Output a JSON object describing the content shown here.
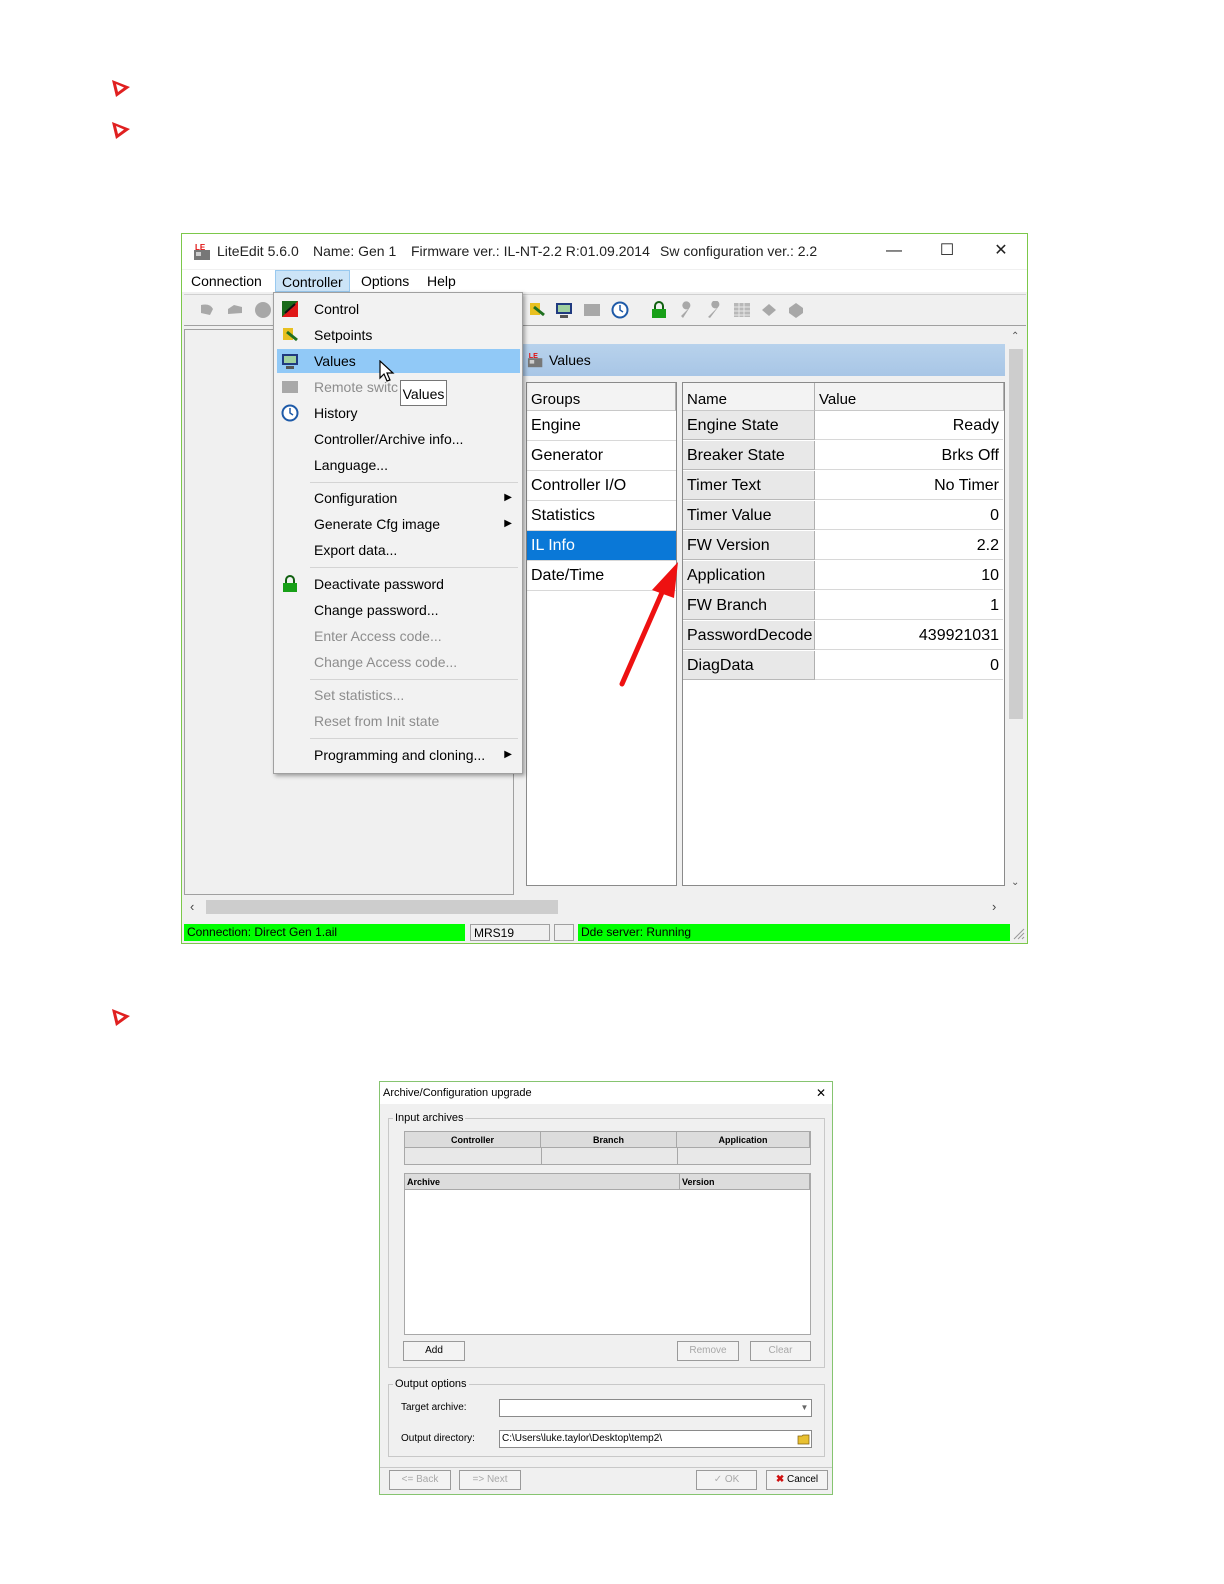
{
  "colors": {
    "accent": "#0a78d7",
    "status_green": "#00ff00",
    "window_border": "#7cc84a",
    "bullet_red": "#e02020",
    "arrow_red": "#ee1111"
  },
  "window1": {
    "title_app": "LiteEdit 5.6.0",
    "title_name": "Name: Gen 1",
    "title_firmware": "Firmware ver.: IL-NT-2.2 R:01.09.2014",
    "title_sw": "Sw configuration ver.: 2.2",
    "controls": {
      "minimize": "—",
      "maximize": "☐",
      "close": "✕"
    },
    "menu": [
      "Connection",
      "Controller",
      "Options",
      "Help"
    ],
    "dropdown": {
      "control": "Control",
      "setpoints": "Setpoints",
      "values": "Values",
      "remote": "Remote switc",
      "history": "History",
      "archive_info": "Controller/Archive info...",
      "language": "Language...",
      "configuration": "Configuration",
      "generate_cfg": "Generate Cfg image",
      "export_data": "Export data...",
      "deactivate_pw": "Deactivate password",
      "change_pw": "Change password...",
      "enter_access": "Enter Access code...",
      "change_access": "Change Access code...",
      "set_statistics": "Set statistics...",
      "reset_init": "Reset from Init state",
      "programming": "Programming and cloning..."
    },
    "tooltip": "Values",
    "values_panel": {
      "title": "Values",
      "groups_header": "Groups",
      "groups": [
        "Engine",
        "Generator",
        "Controller I/O",
        "Statistics",
        "IL Info",
        "Date/Time"
      ],
      "selected_group": "IL Info",
      "name_header": "Name",
      "value_header": "Value",
      "rows": [
        {
          "name": "Engine State",
          "value": "Ready"
        },
        {
          "name": "Breaker State",
          "value": "Brks Off"
        },
        {
          "name": "Timer Text",
          "value": "No Timer"
        },
        {
          "name": "Timer Value",
          "value": "0"
        },
        {
          "name": "FW Version",
          "value": "2.2"
        },
        {
          "name": "Application",
          "value": "10"
        },
        {
          "name": "FW Branch",
          "value": "1"
        },
        {
          "name": "PasswordDecode",
          "value": "439921031"
        },
        {
          "name": "DiagData",
          "value": "0"
        }
      ]
    },
    "status": {
      "connection": "Connection: Direct  Gen 1.ail",
      "device": "MRS19",
      "dde": "Dde server: Running"
    }
  },
  "window2": {
    "title": "Archive/Configuration upgrade",
    "close": "✕",
    "input_archives_label": "Input archives",
    "top_headers": [
      "Controller",
      "Branch",
      "Application"
    ],
    "archive_headers": [
      "Archive",
      "Version"
    ],
    "add": "Add",
    "remove": "Remove",
    "clear": "Clear",
    "output_options_label": "Output options",
    "target_archive_label": "Target archive:",
    "target_archive_value": "",
    "output_dir_label": "Output directory:",
    "output_dir_value": "C:\\Users\\luke.taylor\\Desktop\\temp2\\",
    "back": "<= Back",
    "next": "=> Next",
    "ok": "OK",
    "cancel": "Cancel"
  }
}
